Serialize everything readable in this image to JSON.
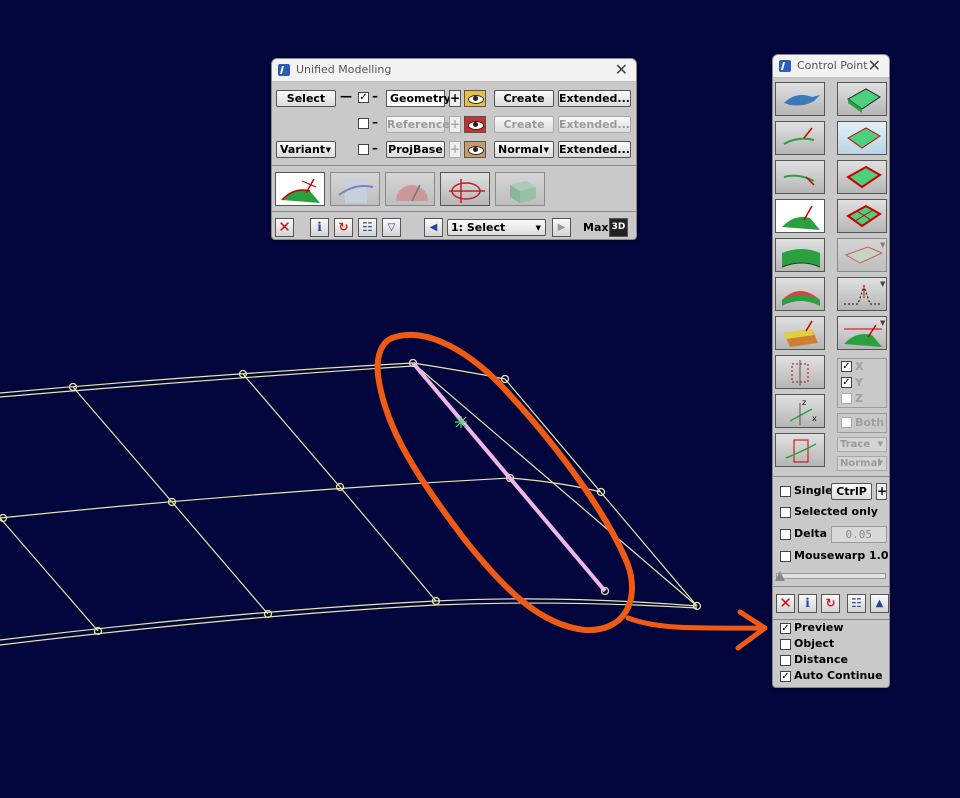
{
  "viewport": {
    "grid_color": "#e8e6a8",
    "highlight_color": "#f0b6e8",
    "annotation_color": "#f05a14"
  },
  "unified": {
    "title": "Unified Modelling",
    "row1": {
      "select": "Select",
      "mode": "Geometry",
      "create": "Create",
      "extended": "Extended...",
      "checked": "✓"
    },
    "row2": {
      "mode": "Reference",
      "create": "Create",
      "extended": "Extended..."
    },
    "row3": {
      "variant": "Variant",
      "mode": "ProjBase",
      "normal": "Normal",
      "extended": "Extended..."
    },
    "tools": [
      "surface-select-tool",
      "curve-tool",
      "gauge-tool",
      "vector-field-tool",
      "box-tool"
    ],
    "statusbar": {
      "step": "1: Select",
      "max_label": "Max",
      "max_badge": "3D"
    }
  },
  "control": {
    "title": "Control Point",
    "axes": {
      "x": "X",
      "y": "Y",
      "z": "Z",
      "x_checked": "✓",
      "y_checked": "✓"
    },
    "both": "Both",
    "trace": "Trace",
    "normal": "Normal",
    "single": "Single",
    "ctrlp": "CtrlP",
    "selected_only": "Selected only",
    "delta": "Delta",
    "delta_value": "0.05",
    "mousewarp": "Mousewarp",
    "mousewarp_value": "1.0",
    "options": [
      {
        "label": "Preview",
        "checked": "✓"
      },
      {
        "label": "Object",
        "checked": ""
      },
      {
        "label": "Distance",
        "checked": ""
      },
      {
        "label": "Auto Continue",
        "checked": "✓"
      }
    ]
  }
}
